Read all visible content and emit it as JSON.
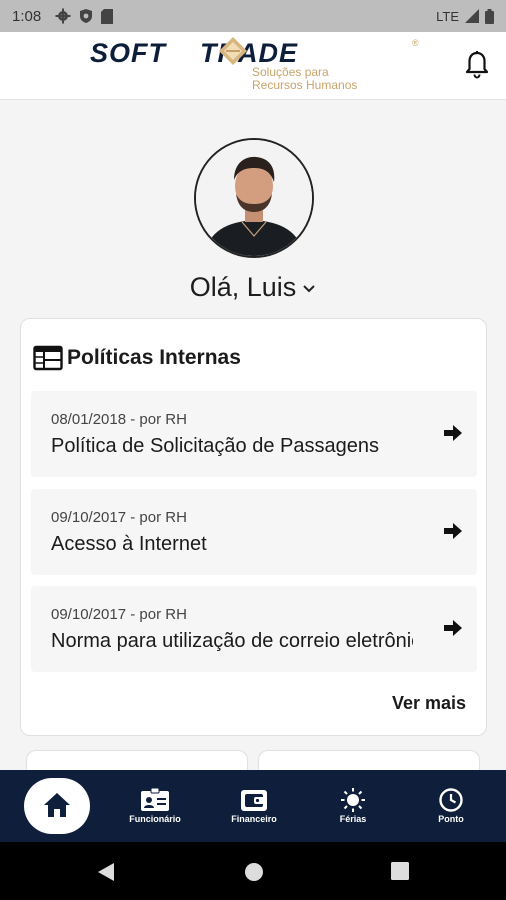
{
  "status_bar": {
    "time": "1:08",
    "network": "LTE"
  },
  "header": {
    "brand_left": "SOFT",
    "brand_right": "TRADE",
    "registered": "®",
    "tagline_line1": "Soluções para",
    "tagline_line2": "Recursos Humanos",
    "brand_color": "#0d1e3a",
    "accent_color": "#c8a46b"
  },
  "profile": {
    "greeting": "Olá, Luis"
  },
  "policies_card": {
    "title": "Políticas Internas",
    "items": [
      {
        "meta": "08/01/2018 - por RH",
        "title": "Política de Solicitação de Passagens"
      },
      {
        "meta": "09/10/2017 - por RH",
        "title": "Acesso à Internet"
      },
      {
        "meta": "09/10/2017 - por RH",
        "title": "Norma para utilização de correio eletrônico"
      }
    ],
    "more_label": "Ver mais"
  },
  "bottom_nav": {
    "background": "#0f1f3b",
    "items": [
      {
        "label": "Funcionário",
        "icon": "id-card-icon"
      },
      {
        "label": "Financeiro",
        "icon": "wallet-icon"
      },
      {
        "label": "Férias",
        "icon": "sun-icon"
      },
      {
        "label": "Ponto",
        "icon": "clock-icon"
      }
    ]
  }
}
